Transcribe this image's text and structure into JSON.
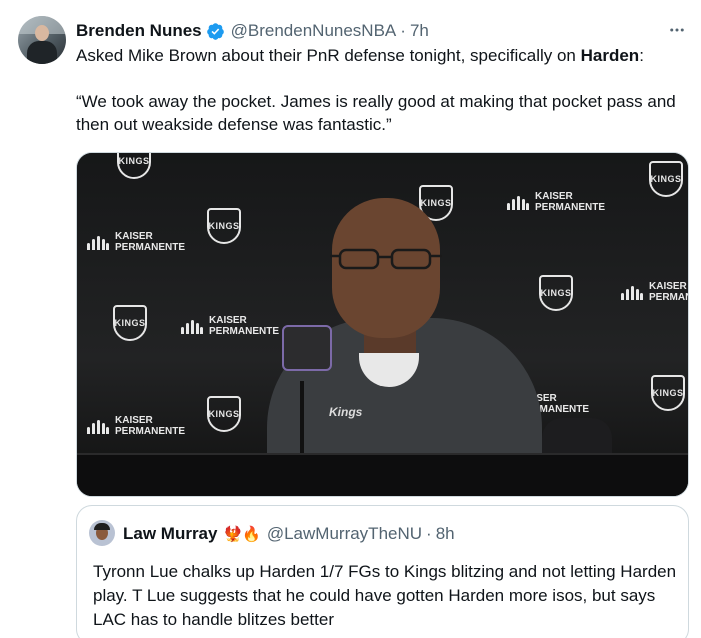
{
  "author": {
    "display_name": "Brenden Nunes",
    "handle": "@BrendenNunesNBA",
    "separator": "·",
    "time": "7h"
  },
  "tweet": {
    "line1_prefix": "Asked Mike Brown about their PnR defense tonight, specifically on ",
    "line1_bold": "Harden",
    "line1_suffix": ":",
    "quote_text": "“We took away the pocket. James is really good at making that pocket pass and then out weakside defense was fantastic.”"
  },
  "media": {
    "sponsor_top": "KAISER",
    "sponsor_bottom": "PERMANENTE",
    "team_logo": "KINGS",
    "jersey_text": "Kings"
  },
  "quoted_tweet": {
    "display_name": "Law Murray",
    "emojis": "🐦‍🔥🔥",
    "handle": "@LawMurrayTheNU",
    "separator": "·",
    "time": "8h",
    "text": "Tyronn Lue chalks up Harden 1/7 FGs to Kings blitzing and not letting Harden play. T Lue suggests that he could have gotten Harden more isos, but says LAC has to handle blitzes better"
  },
  "colors": {
    "verified": "#1d9bf0",
    "secondary_text": "#536471",
    "border": "#cfd9de"
  }
}
